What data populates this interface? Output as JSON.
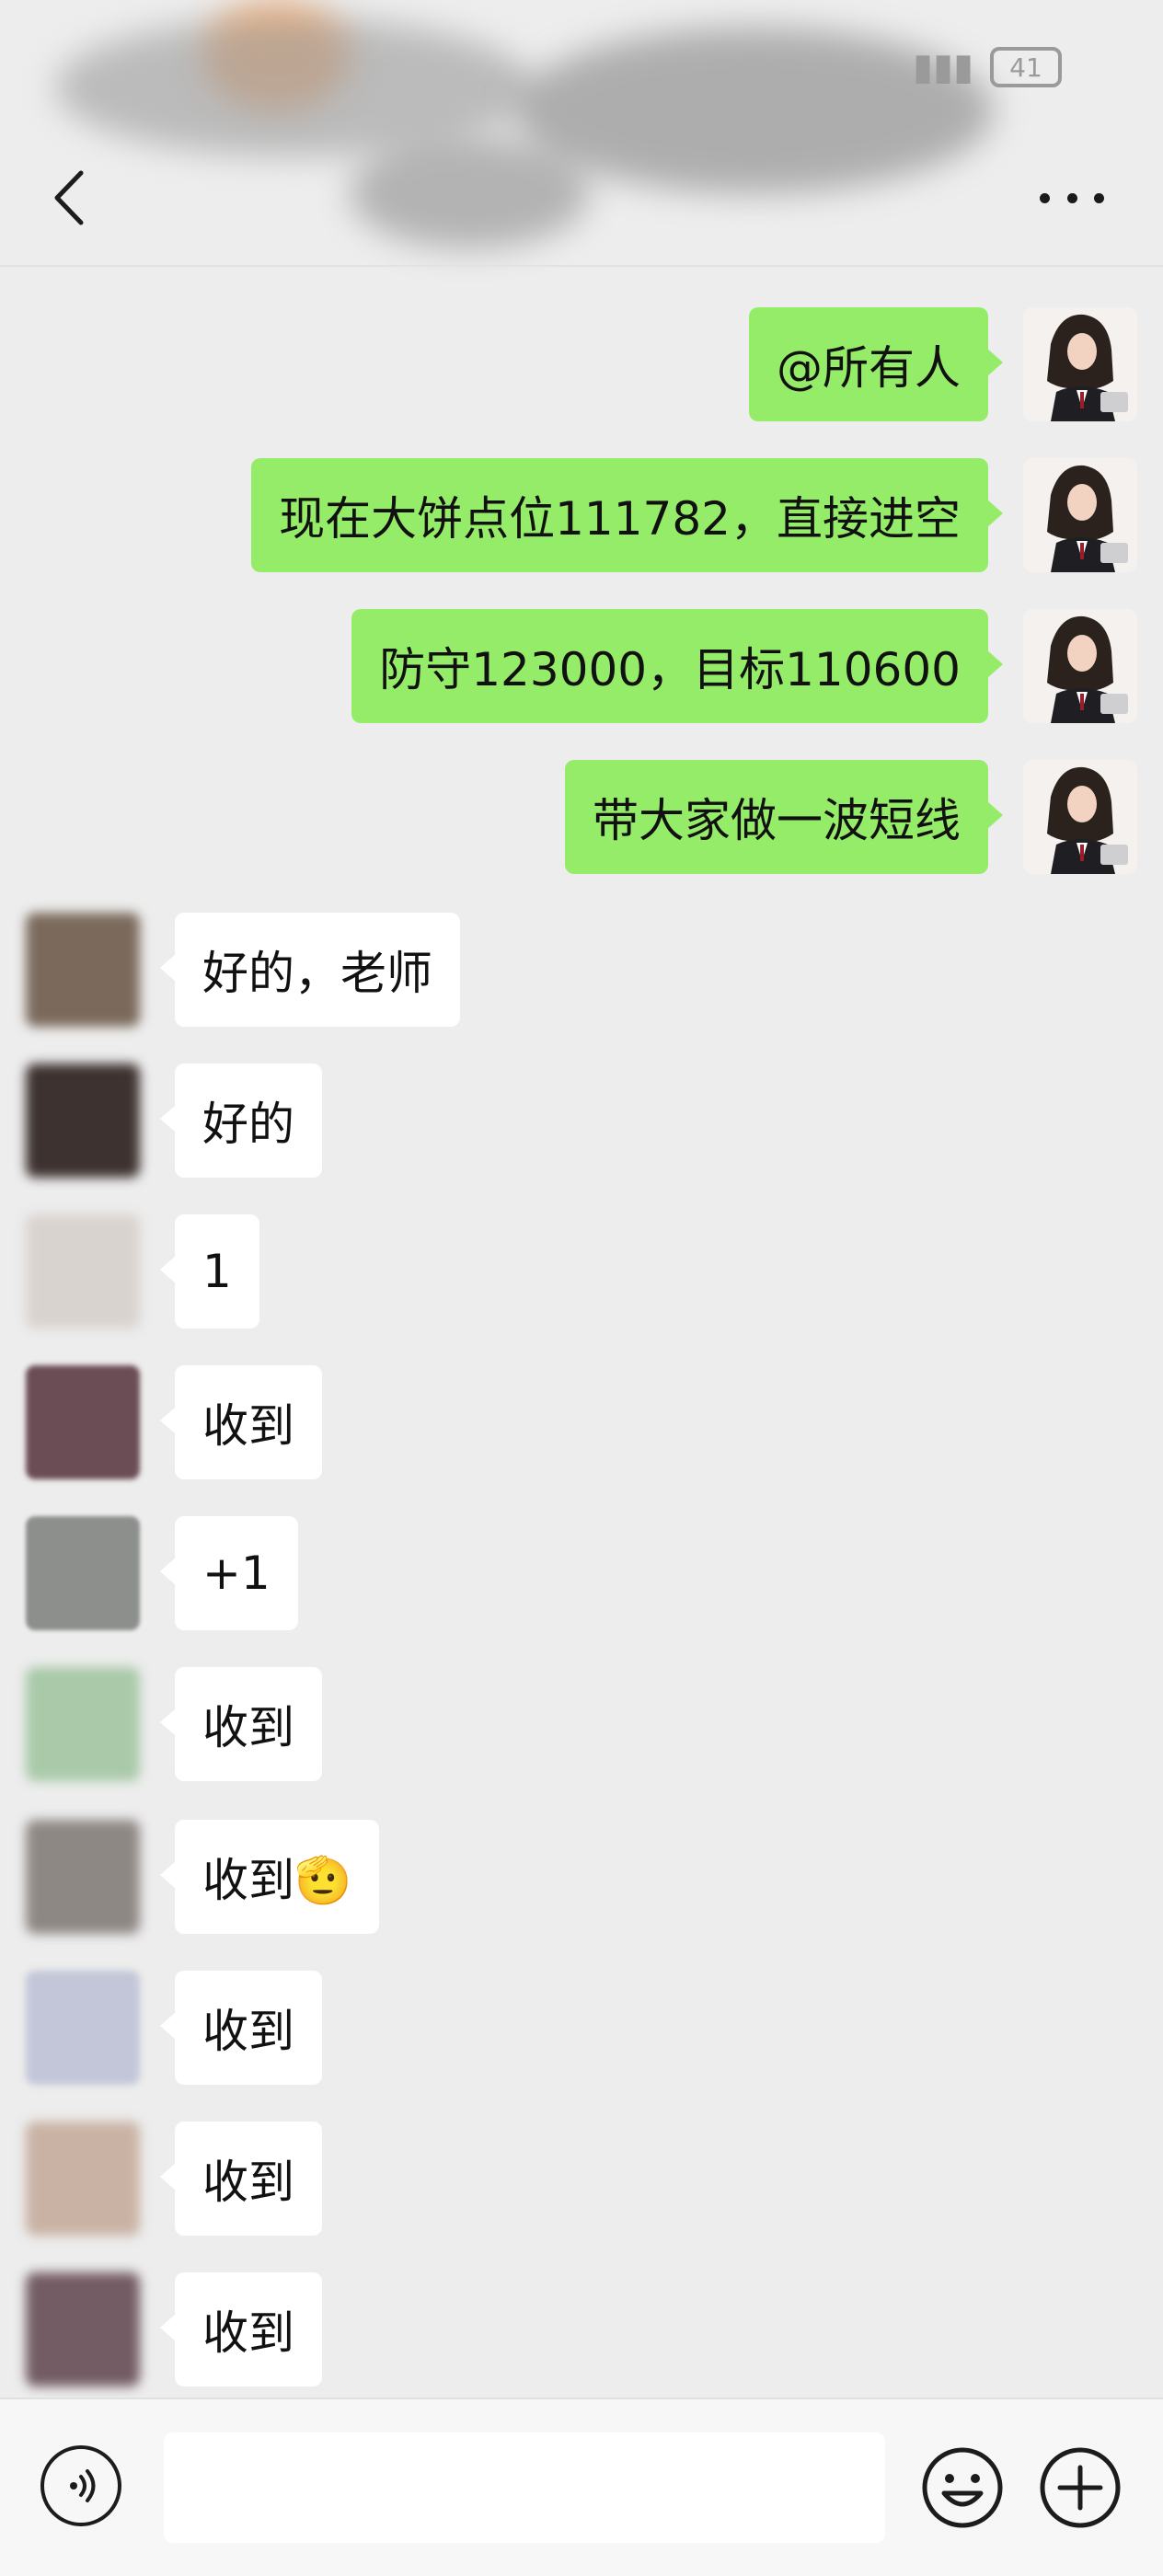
{
  "status_bar": {
    "battery_level": "41"
  },
  "nav": {
    "back_icon": "chevron-left-icon",
    "more_icon": "more-dots-icon"
  },
  "messages": [
    {
      "side": "out",
      "text": "@所有人"
    },
    {
      "side": "out",
      "text": "现在大饼点位111782，直接进空"
    },
    {
      "side": "out",
      "text": "防守123000，目标110600"
    },
    {
      "side": "out",
      "text": "带大家做一波短线"
    },
    {
      "side": "in",
      "text": "好的，老师"
    },
    {
      "side": "in",
      "text": "好的"
    },
    {
      "side": "in",
      "text": "1"
    },
    {
      "side": "in",
      "text": "收到"
    },
    {
      "side": "in",
      "text": "+1"
    },
    {
      "side": "in",
      "text": "收到"
    },
    {
      "side": "in",
      "text": "收到🫡"
    },
    {
      "side": "in",
      "text": "收到"
    },
    {
      "side": "in",
      "text": "收到"
    },
    {
      "side": "in",
      "text": "收到"
    }
  ],
  "input_bar": {
    "message_placeholder": "",
    "voice_icon": "voice-icon",
    "emoji_icon": "emoji-icon",
    "plus_icon": "plus-icon"
  },
  "colors": {
    "outgoing_bubble": "#95ec69",
    "incoming_bubble": "#ffffff",
    "background": "#ededed"
  }
}
